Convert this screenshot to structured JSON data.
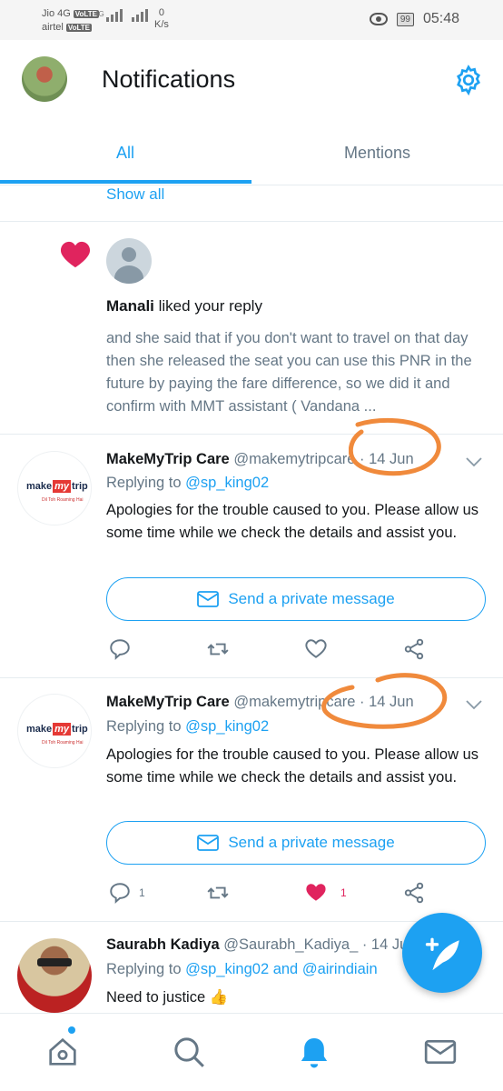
{
  "status_bar": {
    "carrier1": "Jio 4G",
    "carrier2": "airtel",
    "volte": "VoLTE",
    "net_type": "4G",
    "speed_value": "0",
    "speed_unit": "K/s",
    "battery": "99",
    "time": "05:48"
  },
  "header": {
    "title": "Notifications"
  },
  "tabs": [
    {
      "label": "All"
    },
    {
      "label": "Mentions"
    }
  ],
  "show_all": "Show all",
  "like_notification": {
    "user": "Manali",
    "action": " liked your reply",
    "excerpt": "and she said that if you don't want to travel on that day then she released the seat you can use this PNR in the future by paying the fare difference, so we did it and confirm with MMT assistant ( Vandana ..."
  },
  "tweets": [
    {
      "name": "MakeMyTrip Care",
      "handle": " @makemytripcare",
      "sep": " · ",
      "date": "14 Jun",
      "replying_prefix": "Replying to ",
      "replying_to": "@sp_king02",
      "body": "Apologies for the trouble caused to you. Please allow us some time while we check the details and assist you.",
      "dm_label": "Send a private message",
      "reply_count": "",
      "like_count": "",
      "liked": false
    },
    {
      "name": "MakeMyTrip Care",
      "handle": " @makemytripcare",
      "sep": " · ",
      "date": "14 Jun",
      "replying_prefix": "Replying to ",
      "replying_to": "@sp_king02",
      "body": "Apologies for the trouble caused to you. Please allow us some time while we check the details and assist you.",
      "dm_label": "Send a private message",
      "reply_count": "1",
      "like_count": "1",
      "liked": true
    }
  ],
  "mmt_logo": {
    "pre": "make",
    "mid": "my",
    "post": "trip",
    "tagline": "Dil Toh Roaming Hai"
  },
  "tweet3": {
    "name": "Saurabh Kadiya",
    "handle": " @Saurabh_Kadiya_",
    "sep": " · ",
    "date": "14 Ju",
    "replying_prefix": "Replying to ",
    "replying_to": "@sp_king02",
    "and": " and ",
    "replying_to2": "@airindiain",
    "body": "Need to justice 👍"
  },
  "colors": {
    "accent": "#1da1f2",
    "like": "#e0245e",
    "annotation": "#f08a3c",
    "secondary_text": "#657786"
  },
  "icons": {
    "settings": "gear-icon",
    "reply": "reply-icon",
    "retweet": "retweet-icon",
    "like": "heart-icon",
    "share": "share-icon",
    "compose": "compose-icon",
    "home": "home-icon",
    "search": "search-icon",
    "notifications": "bell-icon",
    "messages": "mail-icon"
  }
}
